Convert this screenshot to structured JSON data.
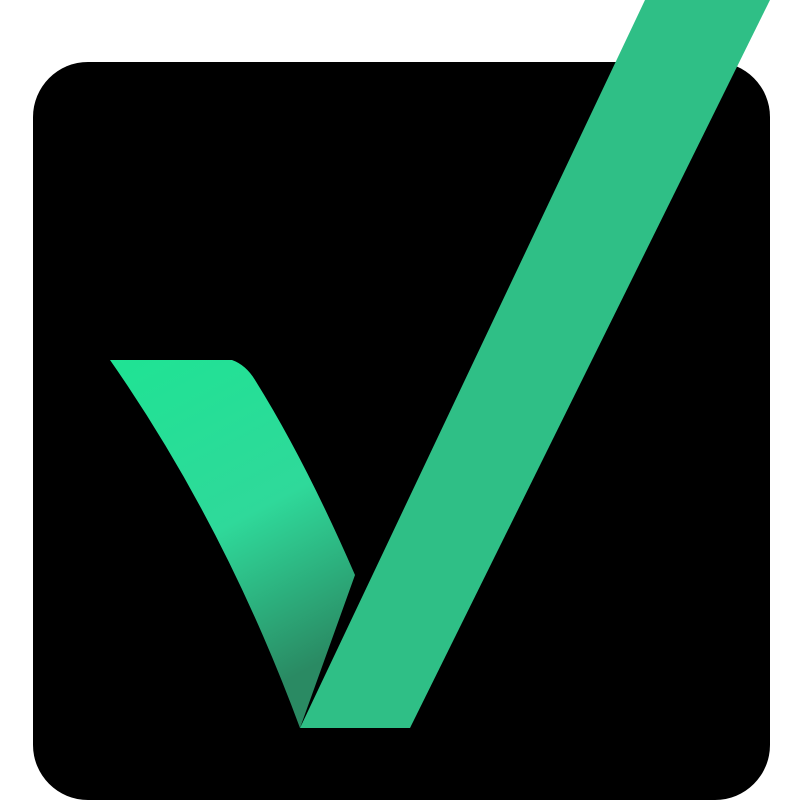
{
  "logo": {
    "icon": "checkmark-icon",
    "background_color": "#000000",
    "page_color": "#ffffff",
    "check_color": "#2fbf86",
    "check_highlight_color": "#1fe394",
    "check_shadow_color": "#2a8a63"
  }
}
